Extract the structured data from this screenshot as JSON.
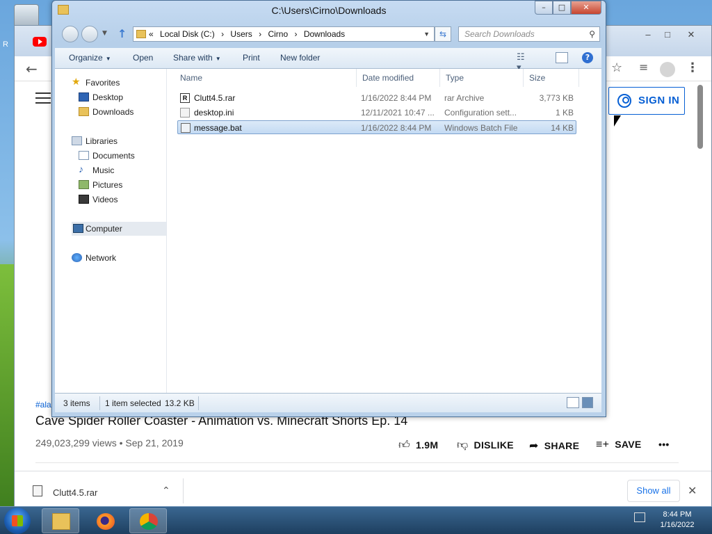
{
  "desktop": {
    "partial_label": "R"
  },
  "chrome": {
    "window_controls": [
      "–",
      "□",
      "✕"
    ],
    "youtube": {
      "sign_in_label": "SIGN IN",
      "hashtag": "#ala",
      "video_title": "Cave Spider Roller Coaster - Animation vs. Minecraft Shorts Ep. 14",
      "video_meta": "249,023,299 views • Sep 21, 2019",
      "like_count": "1.9M",
      "dislike_label": "DISLIKE",
      "share_label": "SHARE",
      "save_label": "SAVE",
      "more_label": "•••"
    },
    "download_bar": {
      "file_name": "Clutt4.5.rar",
      "show_all_label": "Show all"
    }
  },
  "explorer": {
    "title": "C:\\Users\\Cirno\\Downloads",
    "breadcrumb": [
      "«",
      "Local Disk (C:)",
      "›",
      "Users",
      "›",
      "Cirno",
      "›",
      "Downloads"
    ],
    "search_placeholder": "Search Downloads",
    "toolbar": {
      "organize": "Organize",
      "open": "Open",
      "share_with": "Share with",
      "print": "Print",
      "new_folder": "New folder"
    },
    "nav": {
      "favorites": "Favorites",
      "desktop": "Desktop",
      "downloads": "Downloads",
      "libraries": "Libraries",
      "documents": "Documents",
      "music": "Music",
      "pictures": "Pictures",
      "videos": "Videos",
      "computer": "Computer",
      "network": "Network"
    },
    "columns": {
      "name": "Name",
      "date": "Date modified",
      "type": "Type",
      "size": "Size"
    },
    "files": [
      {
        "name": "Clutt4.5.rar",
        "date": "1/16/2022 8:44 PM",
        "type": "rar Archive",
        "size": "3,773 KB"
      },
      {
        "name": "desktop.ini",
        "date": "12/11/2021 10:47 ...",
        "type": "Configuration sett...",
        "size": "1 KB"
      },
      {
        "name": "message.bat",
        "date": "1/16/2022 8:44 PM",
        "type": "Windows Batch File",
        "size": "14 KB"
      }
    ],
    "status": {
      "items": "3 items",
      "selected": "1 item selected",
      "size": "13.2 KB"
    }
  },
  "taskbar": {
    "time": "8:44 PM",
    "date": "1/16/2022"
  }
}
